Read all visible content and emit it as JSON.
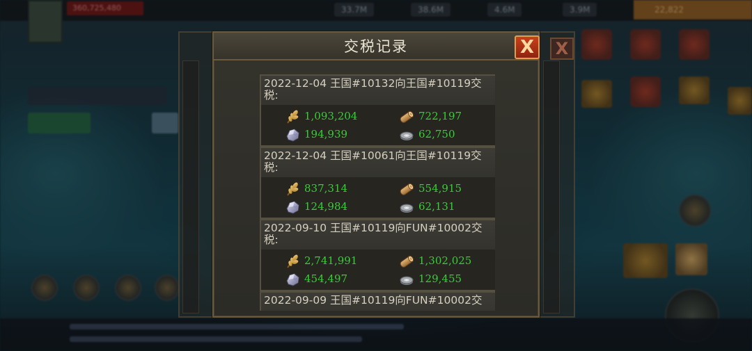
{
  "background": {
    "resources": [
      "33.7M",
      "38.6M",
      "4.6M",
      "3.9M"
    ],
    "gold": "22,822",
    "power": "360,725,480"
  },
  "dialog": {
    "title": "交税记录",
    "close_label": "X"
  },
  "records": [
    {
      "header": "2022-12-04 王国#10132向王国#10119交税:",
      "food": "1,093,204",
      "wood": "722,197",
      "stone": "194,939",
      "silver": "62,750"
    },
    {
      "header": "2022-12-04 王国#10061向王国#10119交税:",
      "food": "837,314",
      "wood": "554,915",
      "stone": "124,984",
      "silver": "62,131"
    },
    {
      "header": "2022-09-10 王国#10119向FUN#10002交税:",
      "food": "2,741,991",
      "wood": "1,302,025",
      "stone": "454,497",
      "silver": "129,455"
    },
    {
      "header": "2022-09-09 王国#10119向FUN#10002交",
      "food": "",
      "wood": "",
      "stone": "",
      "silver": ""
    }
  ],
  "icons": {
    "food": "wheat-icon",
    "wood": "wood-log-icon",
    "stone": "stone-ore-icon",
    "silver": "silver-coin-icon"
  },
  "colors": {
    "value_green": "#33d133",
    "close_red": "#c8401c",
    "frame_gold": "#6b5b3e"
  }
}
